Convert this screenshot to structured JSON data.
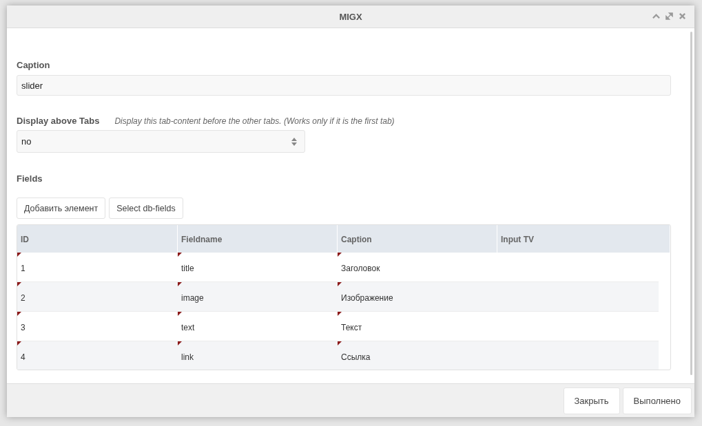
{
  "window": {
    "title": "MIGX"
  },
  "form": {
    "caption": {
      "label": "Caption",
      "value": "slider"
    },
    "display_above": {
      "label": "Display above Tabs",
      "hint": "Display this tab-content before the other tabs. (Works only if it is the first tab)",
      "value": "no"
    },
    "fields_label": "Fields"
  },
  "toolbar": [
    "Добавить элемент",
    "Select db-fields"
  ],
  "table": {
    "columns": [
      "ID",
      "Fieldname",
      "Caption",
      "Input TV"
    ],
    "rows": [
      {
        "cells": [
          {
            "text": "1",
            "modified": true
          },
          {
            "text": "title",
            "modified": true
          },
          {
            "text": "Заголовок",
            "modified": true
          }
        ]
      },
      {
        "cells": [
          {
            "text": "2",
            "modified": true
          },
          {
            "text": "image",
            "modified": true
          },
          {
            "text": "Изображение",
            "modified": true
          }
        ]
      },
      {
        "cells": [
          {
            "text": "3",
            "modified": true
          },
          {
            "text": "text",
            "modified": true
          },
          {
            "text": "Текст",
            "modified": true
          }
        ]
      },
      {
        "cells": [
          {
            "text": "4",
            "modified": true
          },
          {
            "text": "link",
            "modified": true
          },
          {
            "text": "Ссылка",
            "modified": true
          }
        ]
      }
    ]
  },
  "buttons": [
    "Закрыть",
    "Выполнено"
  ]
}
